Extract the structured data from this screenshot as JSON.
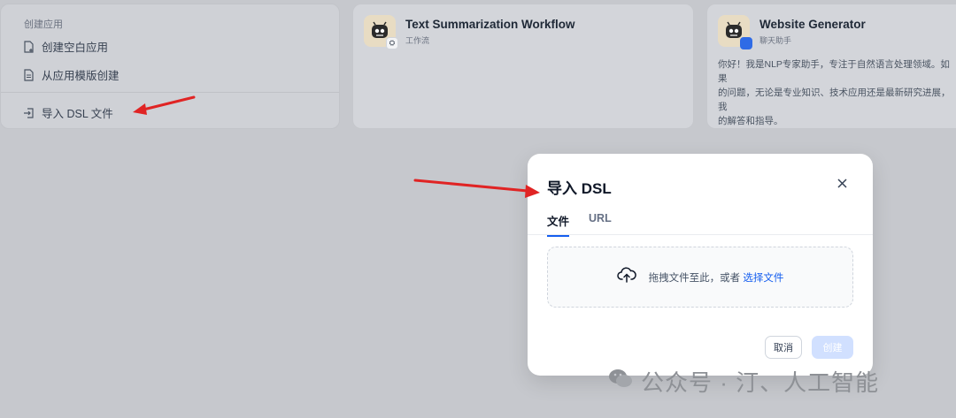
{
  "create_card": {
    "title": "创建应用",
    "items": [
      {
        "label": "创建空白应用",
        "icon": "new-file-icon"
      },
      {
        "label": "从应用模版创建",
        "icon": "template-file-icon"
      },
      {
        "label": "导入 DSL 文件",
        "icon": "import-icon"
      }
    ]
  },
  "templates": [
    {
      "name": "Text Summarization Workflow",
      "type": "工作流",
      "description": "",
      "icon": "robot-avatar-icon"
    },
    {
      "name": "Website Generator",
      "type": "聊天助手",
      "description": "你好！我是NLP专家助手，专注于自然语言处理领域。如果\n的问题，无论是专业知识、技术应用还是最新研究进展，我\n的解答和指导。",
      "icon": "robot-avatar-icon"
    }
  ],
  "modal": {
    "title": "导入 DSL",
    "tabs": [
      {
        "label": "文件",
        "active": true
      },
      {
        "label": "URL",
        "active": false
      }
    ],
    "dropzone": {
      "text": "拖拽文件至此，或者 ",
      "link": "选择文件",
      "icon": "upload-cloud-icon"
    },
    "cancel_label": "取消",
    "create_label": "创建"
  },
  "watermark": "公众号 · 汀、人工智能",
  "colors": {
    "accent": "#155eef",
    "annotation_arrow": "#e02424",
    "overlay": "#c6c8cd"
  }
}
